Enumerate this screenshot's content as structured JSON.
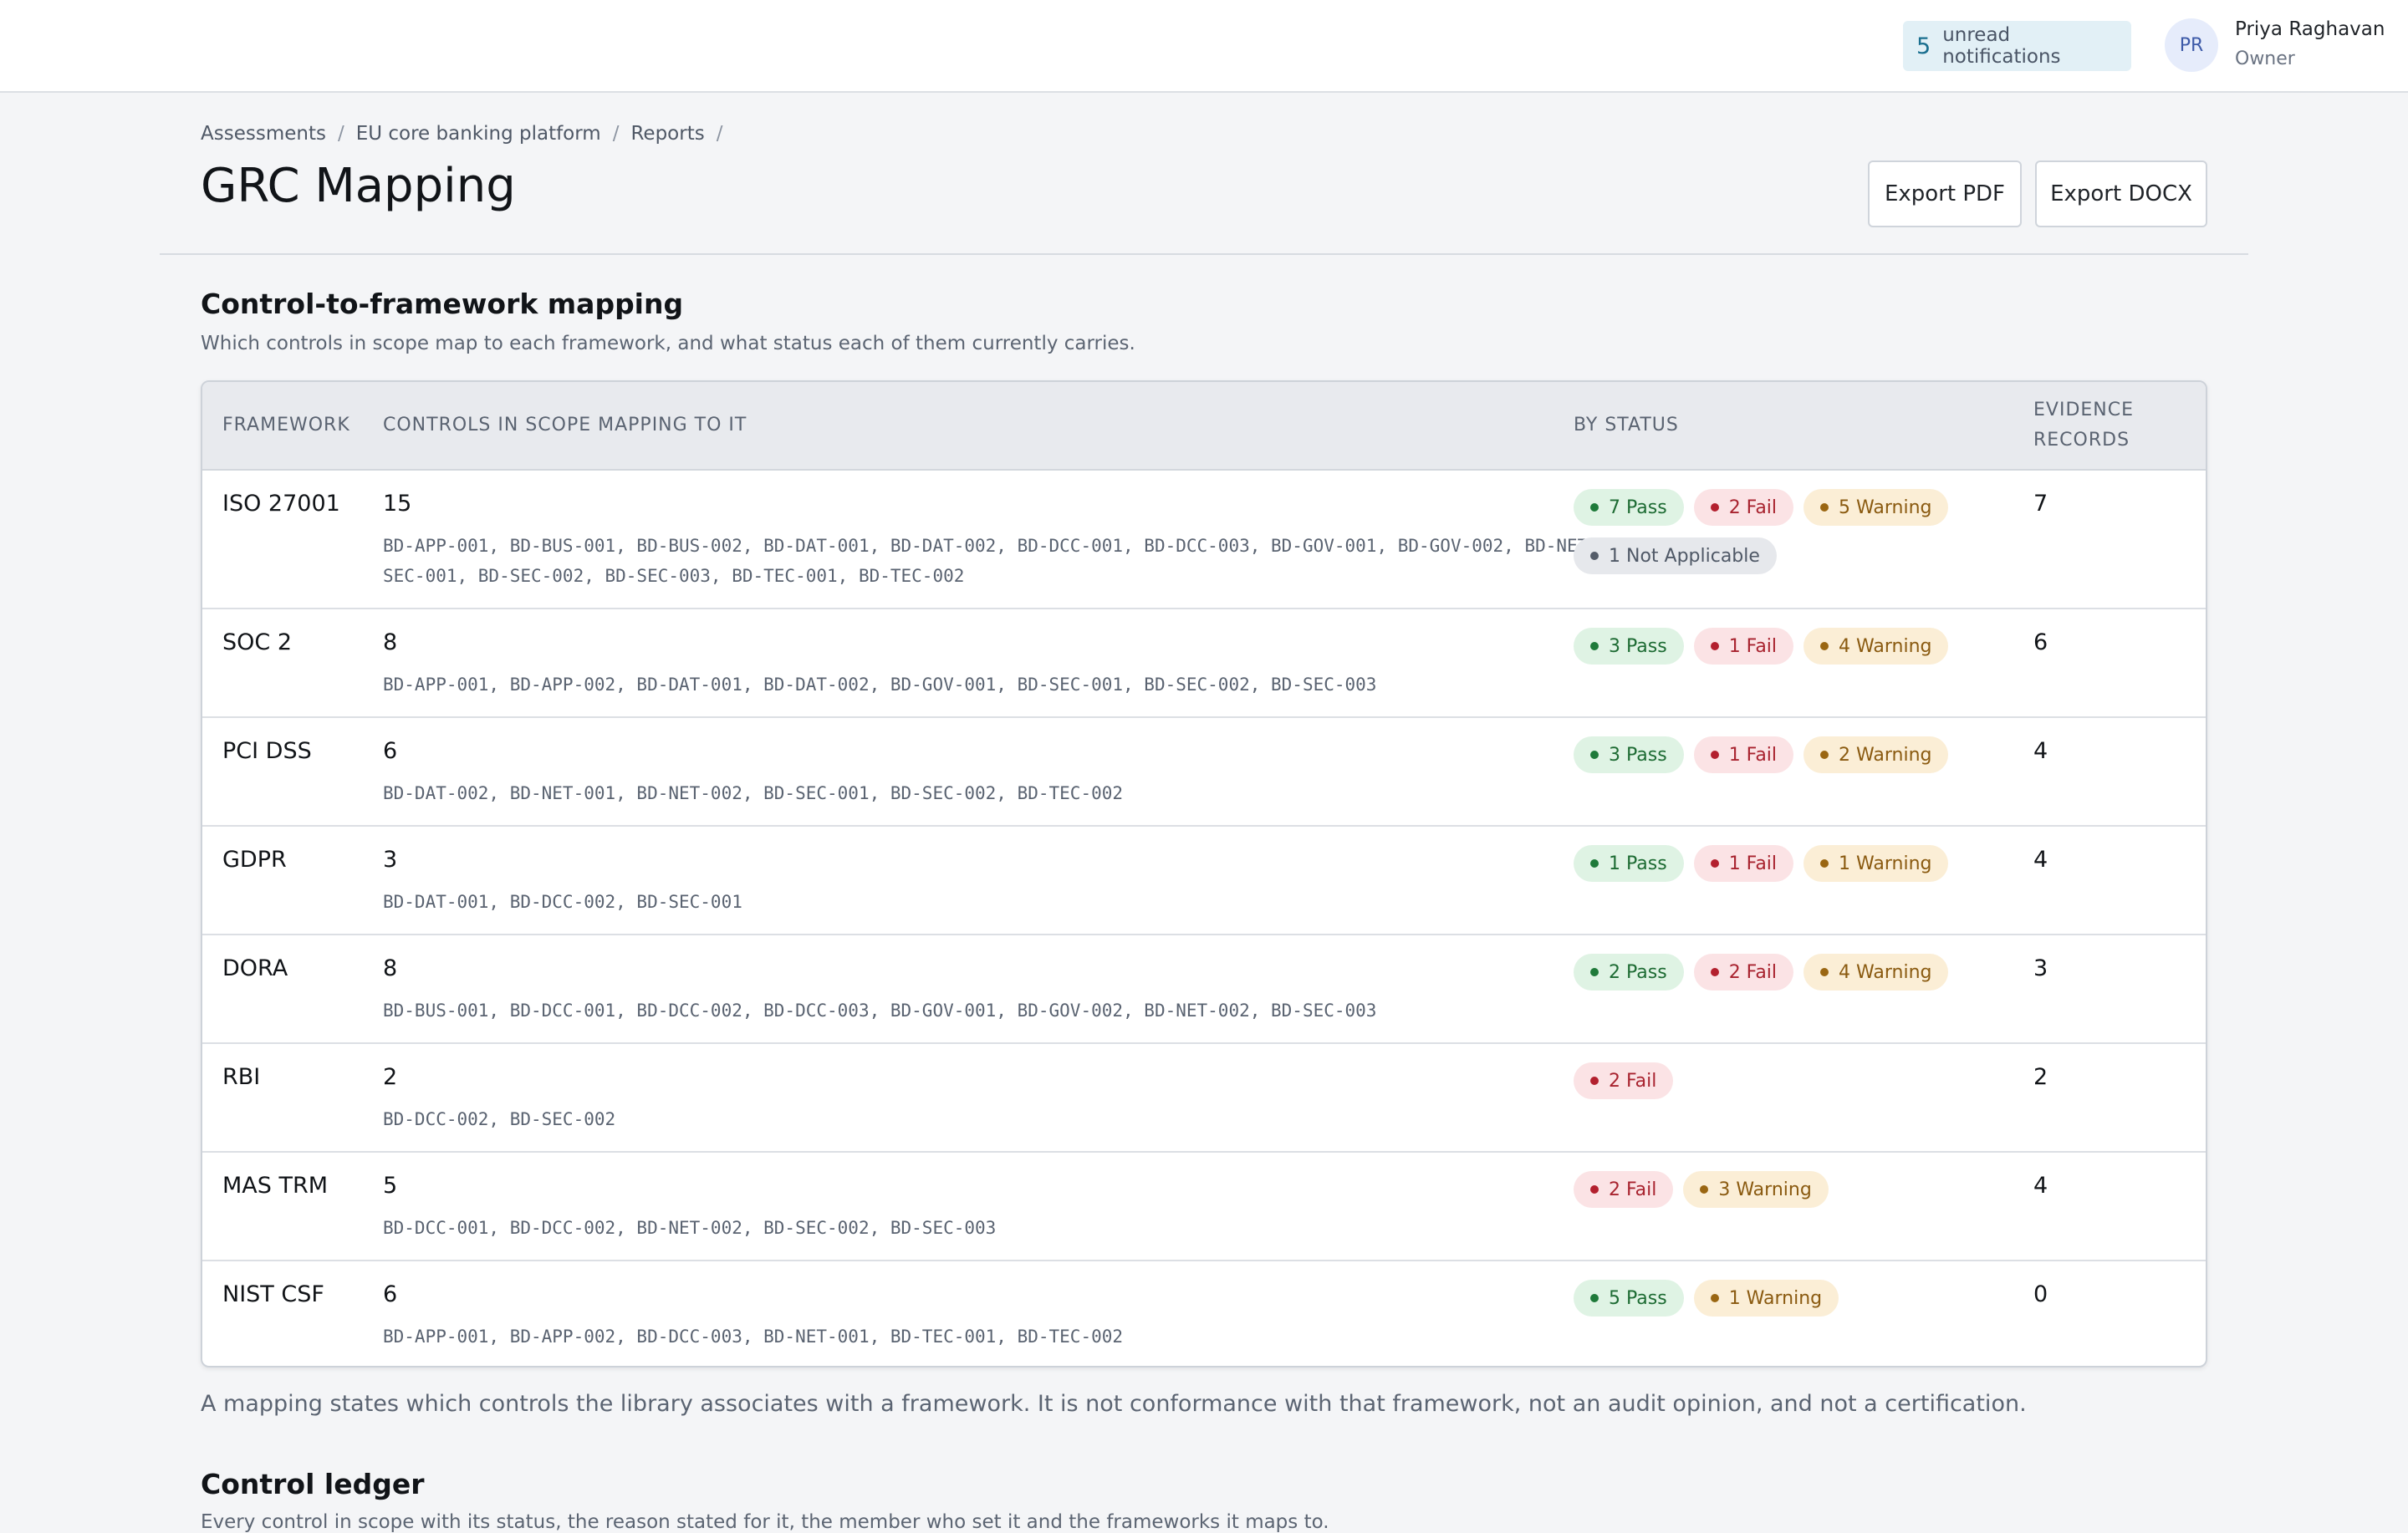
{
  "topbar": {
    "notifications_count": "5",
    "notifications_label": "unread notifications",
    "user_initials": "PR",
    "user_name": "Priya Raghavan",
    "user_role": "Owner"
  },
  "breadcrumb": [
    "Assessments",
    "EU core banking platform",
    "Reports"
  ],
  "page_title": "GRC Mapping",
  "actions": {
    "export_pdf": "Export PDF",
    "export_docx": "Export DOCX"
  },
  "mapping_section": {
    "title": "Control-to-framework mapping",
    "description": "Which controls in scope map to each framework, and what status each of them currently carries.",
    "columns": [
      "FRAMEWORK",
      "CONTROLS IN SCOPE MAPPING TO IT",
      "BY STATUS",
      "EVIDENCE RECORDS"
    ],
    "rows": [
      {
        "framework": "ISO 27001",
        "count": "15",
        "controls": "BD-APP-001, BD-BUS-001, BD-BUS-002, BD-DAT-001, BD-DAT-002, BD-DCC-001, BD-DCC-003, BD-GOV-001, BD-GOV-002, BD-NET-001, BD-SEC-001, BD-SEC-002, BD-SEC-003, BD-TEC-001, BD-TEC-002",
        "statuses": [
          {
            "kind": "pass",
            "label": "7 Pass"
          },
          {
            "kind": "fail",
            "label": "2 Fail"
          },
          {
            "kind": "warn",
            "label": "5 Warning"
          },
          {
            "kind": "na",
            "label": "1 Not Applicable"
          }
        ],
        "evidence": "7"
      },
      {
        "framework": "SOC 2",
        "count": "8",
        "controls": "BD-APP-001, BD-APP-002, BD-DAT-001, BD-DAT-002, BD-GOV-001, BD-SEC-001, BD-SEC-002, BD-SEC-003",
        "statuses": [
          {
            "kind": "pass",
            "label": "3 Pass"
          },
          {
            "kind": "fail",
            "label": "1 Fail"
          },
          {
            "kind": "warn",
            "label": "4 Warning"
          }
        ],
        "evidence": "6"
      },
      {
        "framework": "PCI DSS",
        "count": "6",
        "controls": "BD-DAT-002, BD-NET-001, BD-NET-002, BD-SEC-001, BD-SEC-002, BD-TEC-002",
        "statuses": [
          {
            "kind": "pass",
            "label": "3 Pass"
          },
          {
            "kind": "fail",
            "label": "1 Fail"
          },
          {
            "kind": "warn",
            "label": "2 Warning"
          }
        ],
        "evidence": "4"
      },
      {
        "framework": "GDPR",
        "count": "3",
        "controls": "BD-DAT-001, BD-DCC-002, BD-SEC-001",
        "statuses": [
          {
            "kind": "pass",
            "label": "1 Pass"
          },
          {
            "kind": "fail",
            "label": "1 Fail"
          },
          {
            "kind": "warn",
            "label": "1 Warning"
          }
        ],
        "evidence": "4"
      },
      {
        "framework": "DORA",
        "count": "8",
        "controls": "BD-BUS-001, BD-DCC-001, BD-DCC-002, BD-DCC-003, BD-GOV-001, BD-GOV-002, BD-NET-002, BD-SEC-003",
        "statuses": [
          {
            "kind": "pass",
            "label": "2 Pass"
          },
          {
            "kind": "fail",
            "label": "2 Fail"
          },
          {
            "kind": "warn",
            "label": "4 Warning"
          }
        ],
        "evidence": "3"
      },
      {
        "framework": "RBI",
        "count": "2",
        "controls": "BD-DCC-002, BD-SEC-002",
        "statuses": [
          {
            "kind": "fail",
            "label": "2 Fail"
          }
        ],
        "evidence": "2"
      },
      {
        "framework": "MAS TRM",
        "count": "5",
        "controls": "BD-DCC-001, BD-DCC-002, BD-NET-002, BD-SEC-002, BD-SEC-003",
        "statuses": [
          {
            "kind": "fail",
            "label": "2 Fail"
          },
          {
            "kind": "warn",
            "label": "3 Warning"
          }
        ],
        "evidence": "4"
      },
      {
        "framework": "NIST CSF",
        "count": "6",
        "controls": "BD-APP-001, BD-APP-002, BD-DCC-003, BD-NET-001, BD-TEC-001, BD-TEC-002",
        "statuses": [
          {
            "kind": "pass",
            "label": "5 Pass"
          },
          {
            "kind": "warn",
            "label": "1 Warning"
          }
        ],
        "evidence": "0"
      }
    ]
  },
  "mapping_note": "A mapping states which controls the library associates with a framework. It is not conformance with that framework, not an audit opinion, and not a certification.",
  "ledger_section": {
    "title": "Control ledger",
    "description": "Every control in scope with its status, the reason stated for it, the member who set it and the frameworks it maps to."
  },
  "colors": {
    "pass": "#1f7a3a",
    "fail": "#b3202e",
    "warning": "#9a6612",
    "not_applicable": "#555d69"
  }
}
